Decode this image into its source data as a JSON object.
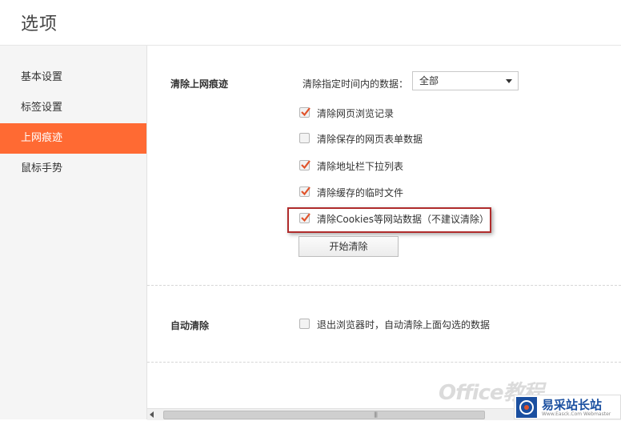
{
  "header": {
    "title": "选项"
  },
  "sidebar": {
    "items": [
      {
        "label": "基本设置"
      },
      {
        "label": "标签设置"
      },
      {
        "label": "上网痕迹"
      },
      {
        "label": "鼠标手势"
      }
    ]
  },
  "clear_traces": {
    "title": "清除上网痕迹",
    "range_label": "清除指定时间内的数据：",
    "range_value": "全部",
    "options": [
      {
        "label": "清除网页浏览记录",
        "checked": true
      },
      {
        "label": "清除保存的网页表单数据",
        "checked": false
      },
      {
        "label": "清除地址栏下拉列表",
        "checked": true
      },
      {
        "label": "清除缓存的临时文件",
        "checked": true
      },
      {
        "label": "清除Cookies等网站数据（不建议清除）",
        "checked": true
      }
    ],
    "button_label": "开始清除"
  },
  "auto_clear": {
    "title": "自动清除",
    "option": {
      "label": "退出浏览器时，自动清除上面勾选的数据",
      "checked": false
    }
  },
  "watermark": {
    "text": "Office教程"
  },
  "logo": {
    "text": "易采站长站",
    "sub": "Www.Easck.Com Webmaster"
  },
  "colors": {
    "accent": "#ff6a33",
    "check": "#e0532b",
    "highlight_border": "#b02c2c"
  }
}
